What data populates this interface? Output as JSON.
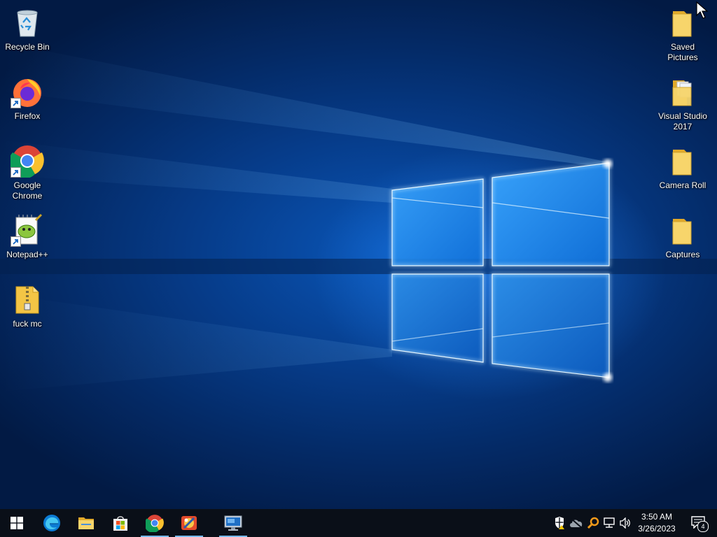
{
  "desktop": {
    "left_icons": [
      {
        "label": "Recycle Bin",
        "icon": "recycle-bin-icon"
      },
      {
        "label": "Firefox",
        "icon": "firefox-icon"
      },
      {
        "label": "Google Chrome",
        "icon": "chrome-icon"
      },
      {
        "label": "Notepad++",
        "icon": "notepadpp-icon"
      },
      {
        "label": "fuck mc",
        "icon": "zip-folder-icon"
      }
    ],
    "right_icons": [
      {
        "label": "Saved Pictures",
        "icon": "folder-icon"
      },
      {
        "label": "Visual Studio 2017",
        "icon": "folder-icon"
      },
      {
        "label": "Camera Roll",
        "icon": "folder-icon"
      },
      {
        "label": "Captures",
        "icon": "folder-icon"
      }
    ]
  },
  "taskbar": {
    "pinned": [
      {
        "name": "start-button",
        "icon": "windows-logo-icon"
      },
      {
        "name": "taskbar-edge",
        "icon": "edge-icon"
      },
      {
        "name": "taskbar-file-explorer",
        "icon": "folder-icon"
      },
      {
        "name": "taskbar-store",
        "icon": "store-icon"
      },
      {
        "name": "taskbar-chrome",
        "icon": "chrome-icon"
      },
      {
        "name": "taskbar-app",
        "icon": "app-icon"
      },
      {
        "name": "taskbar-remote-desktop",
        "icon": "remote-desktop-icon"
      }
    ],
    "tray": {
      "time": "3:50 AM",
      "date": "3/26/2023",
      "notification_count": "4"
    }
  },
  "colors": {
    "wallpaper": "#0a56b8",
    "taskbar": "#0a0f18",
    "active_indicator": "#76b9ed",
    "folder": "#f3c545"
  }
}
